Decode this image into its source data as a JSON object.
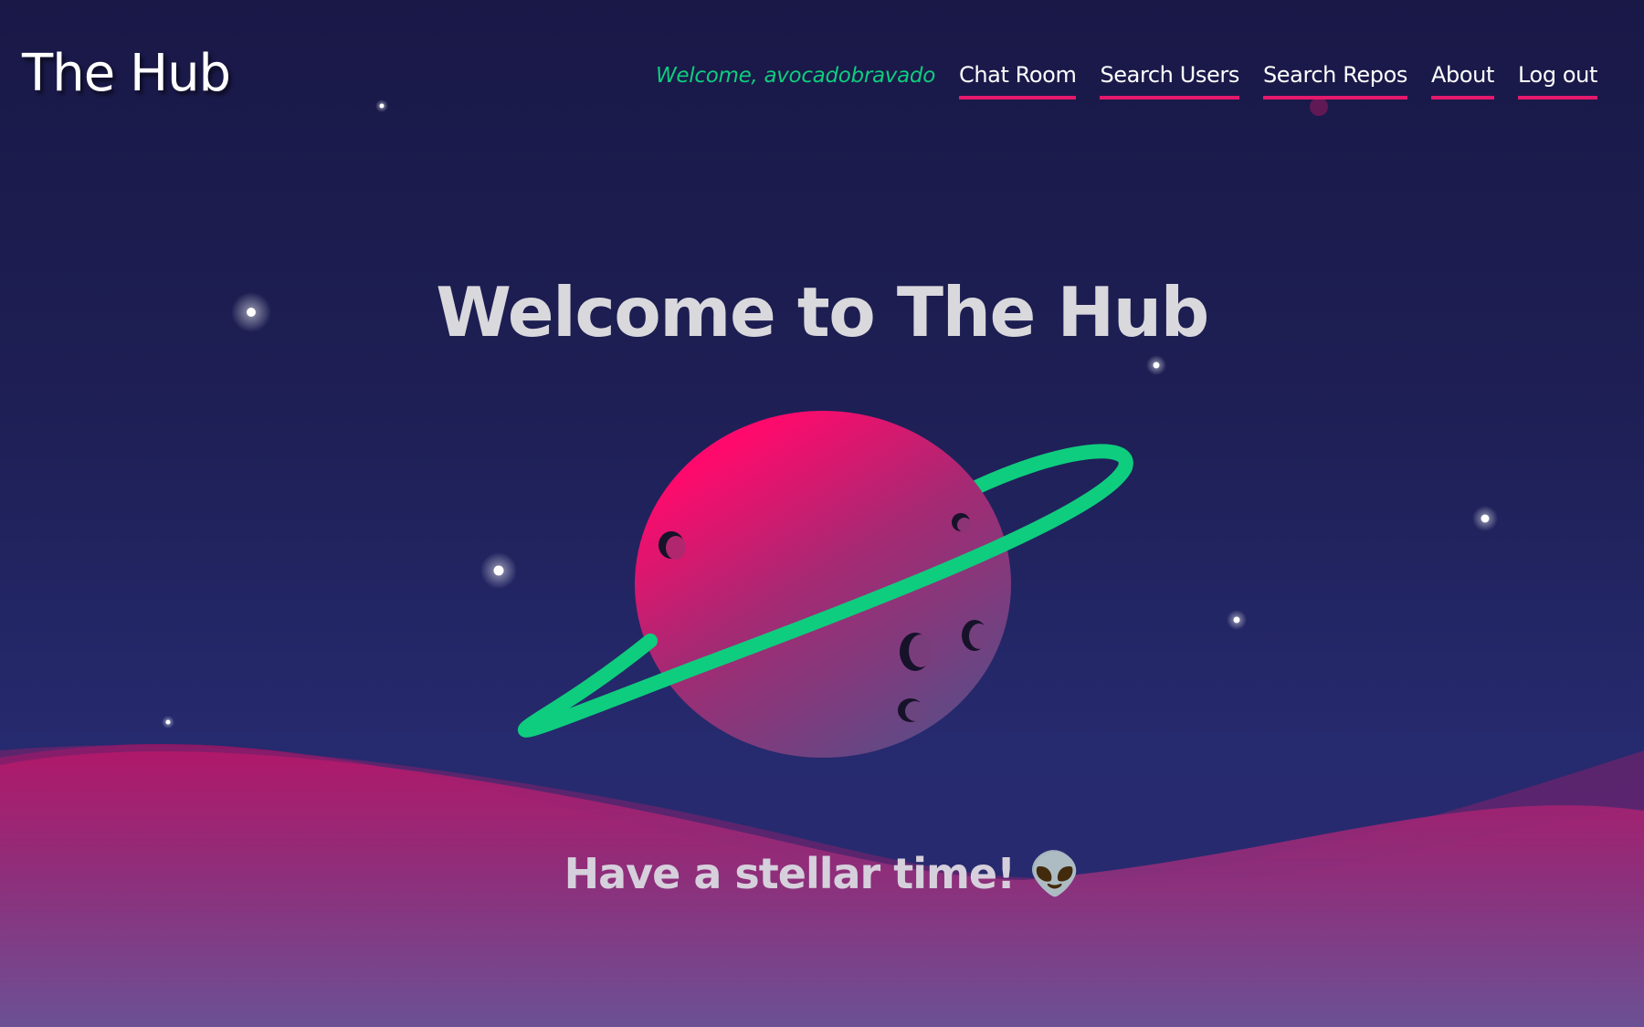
{
  "header": {
    "logo": "The Hub",
    "welcome": "Welcome, avocadobravado",
    "nav": [
      {
        "label": "Chat Room"
      },
      {
        "label": "Search Users"
      },
      {
        "label": "Search Repos"
      },
      {
        "label": "About"
      },
      {
        "label": "Log out"
      }
    ]
  },
  "hero": {
    "title": "Welcome to The Hub",
    "tagline": "Have a stellar time! 👽"
  },
  "icons": {
    "planet": "planet-illustration",
    "alien": "alien-emoji"
  },
  "colors": {
    "background_top": "#191847",
    "background_bottom": "#2a2b70",
    "accent_pink": "#e5196b",
    "accent_green": "#0fcd7e",
    "planet_pink": "#ff0a6c",
    "planet_muted": "#6b4a85",
    "text_light": "#d9d8dc"
  }
}
